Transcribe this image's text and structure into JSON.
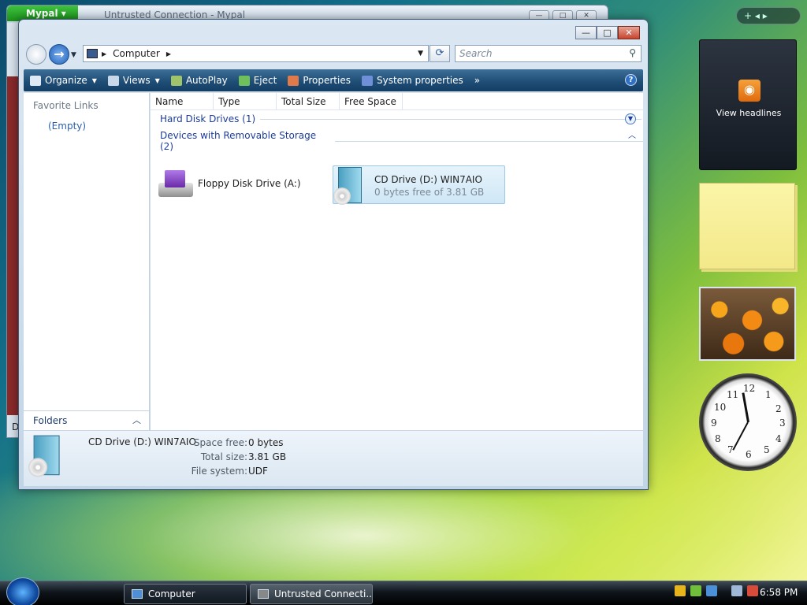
{
  "background_window": {
    "title": "Untrusted Connection - Mypal",
    "app_button": "Mypal",
    "left_letter": "D"
  },
  "window": {
    "address": {
      "location": "Computer"
    },
    "search": {
      "placeholder": "Search"
    },
    "toolbar": {
      "items": [
        {
          "label": "Organize",
          "icon": "organize-icon",
          "dropdown": true
        },
        {
          "label": "Views",
          "icon": "views-icon",
          "dropdown": true
        },
        {
          "label": "AutoPlay",
          "icon": "autoplay-icon"
        },
        {
          "label": "Eject",
          "icon": "eject-icon"
        },
        {
          "label": "Properties",
          "icon": "properties-icon"
        },
        {
          "label": "System properties",
          "icon": "system-properties-icon"
        }
      ],
      "more": "»",
      "help": "?"
    },
    "left_pane": {
      "title": "Favorite Links",
      "empty": "(Empty)",
      "folders_label": "Folders"
    },
    "columns": [
      "Name",
      "Type",
      "Total Size",
      "Free Space"
    ],
    "groups": [
      {
        "label": "Hard Disk Drives (1)"
      },
      {
        "label": "Devices with Removable Storage (2)"
      }
    ],
    "devices": [
      {
        "name": "Floppy Disk Drive (A:)",
        "detail": ""
      },
      {
        "name": "CD Drive (D:) WIN7AIO",
        "detail": "0 bytes free of 3.81 GB"
      }
    ],
    "details": {
      "name": "CD Drive (D:) WIN7AIO",
      "space_free_label": "Space free:",
      "space_free": "0 bytes",
      "total_size_label": "Total size:",
      "total_size": "3.81 GB",
      "file_system_label": "File system:",
      "file_system": "UDF"
    }
  },
  "sidebar": {
    "controls": "+  ◂ ▸",
    "feed_label": "View headlines"
  },
  "clock_numbers": [
    "12",
    "1",
    "2",
    "3",
    "4",
    "5",
    "6",
    "7",
    "8",
    "9",
    "10",
    "11"
  ],
  "taskbar": {
    "tasks": [
      "Computer",
      "Untrusted Connecti..."
    ],
    "time": "6:58 PM"
  },
  "colors": {
    "toolbar": "#1f4e77",
    "link": "#1d3c9a",
    "selection": "#cfe7f6"
  }
}
